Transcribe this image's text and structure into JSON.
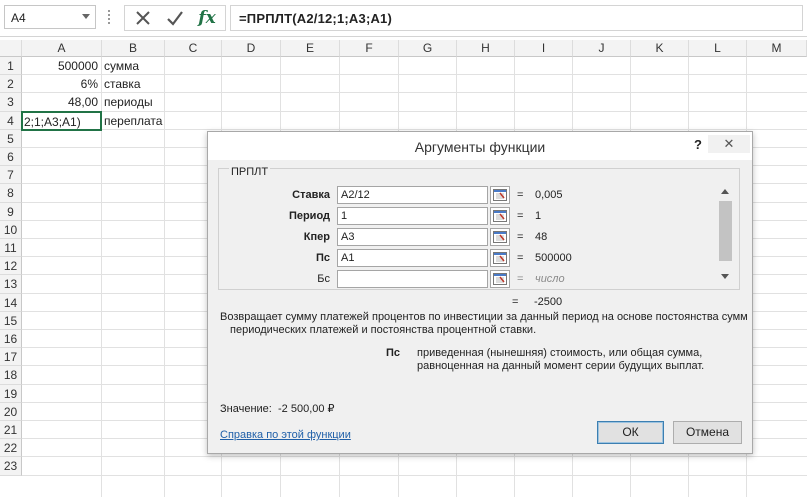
{
  "formula_bar": {
    "name_box": "A4",
    "formula": "=ПРПЛТ(A2/12;1;A3;A1)",
    "fx_label": "fx"
  },
  "columns": [
    "A",
    "B",
    "C",
    "D",
    "E",
    "F",
    "G",
    "H",
    "I",
    "J",
    "K",
    "L",
    "M"
  ],
  "rows": [
    "1",
    "2",
    "3",
    "4",
    "5",
    "6",
    "7",
    "8",
    "9",
    "10",
    "11",
    "12",
    "13",
    "14",
    "15",
    "16",
    "17",
    "18",
    "19",
    "20",
    "21",
    "22",
    "23"
  ],
  "cells": {
    "A1": "500000",
    "B1": "сумма",
    "A2": "6%",
    "B2": "ставка",
    "A3": "48,00",
    "B3": "периоды",
    "A4_edit": "2;1;A3;A1)",
    "B4": "переплата"
  },
  "dialog": {
    "title": "Аргументы функции",
    "help_button": "?",
    "close_button": "✕",
    "function_name": "ПРПЛТ",
    "args": [
      {
        "label": "Ставка",
        "value": "A2/12",
        "result": "0,005"
      },
      {
        "label": "Период",
        "value": "1",
        "result": "1"
      },
      {
        "label": "Кпер",
        "value": "A3",
        "result": "48"
      },
      {
        "label": "Пс",
        "value": "A1",
        "result": "500000"
      },
      {
        "label": "Бс",
        "value": "",
        "result": "число"
      }
    ],
    "equals": "=",
    "formula_result": "-2500",
    "description_line1": "Возвращает сумму платежей процентов по инвестиции за данный период на основе постоянства сумм",
    "description_line2": "периодических платежей и постоянства процентной ставки.",
    "arg_help_name": "Пс",
    "arg_help_line1": "приведенная (нынешняя) стоимость, или общая сумма,",
    "arg_help_line2": "равноценная на данный момент серии будущих выплат.",
    "value_label": "Значение:",
    "value": "-2 500,00 ₽",
    "help_link": "Справка по этой функции",
    "ok": "ОК",
    "cancel": "Отмена"
  }
}
